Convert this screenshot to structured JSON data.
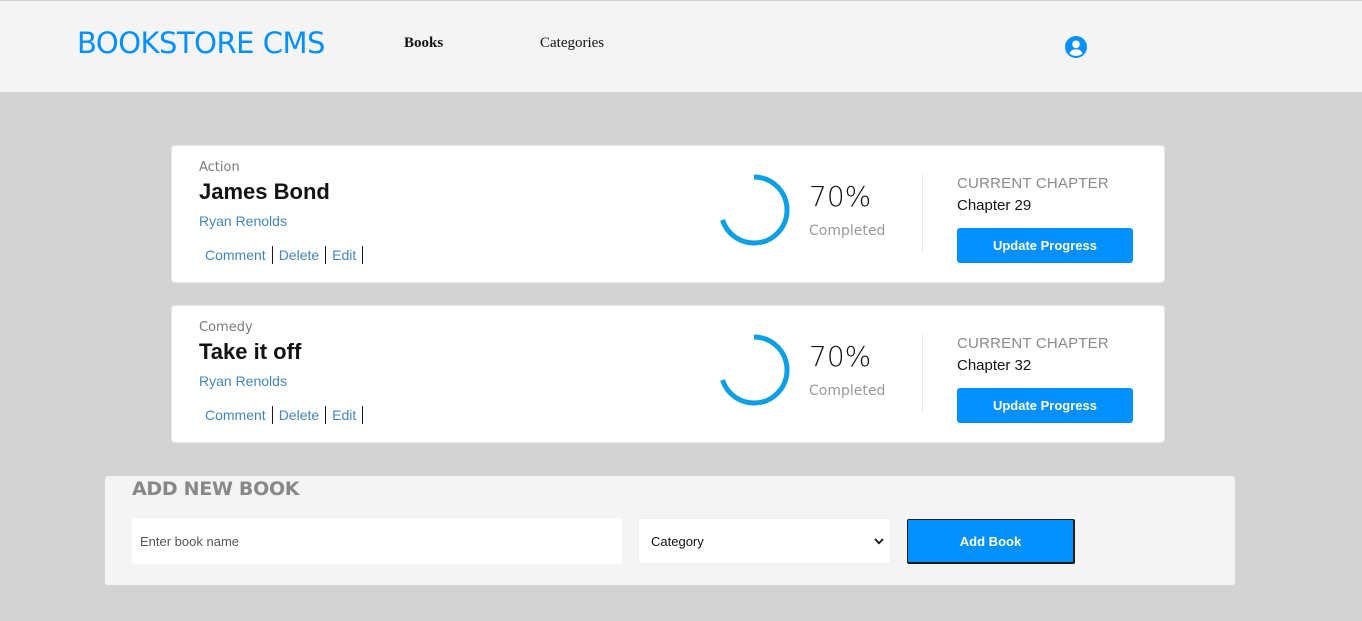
{
  "header": {
    "brand": "BOOKSTORE CMS",
    "nav": {
      "books": "Books",
      "categories": "Categories"
    },
    "user_icon": "user-circle-icon"
  },
  "books": [
    {
      "genre": "Action",
      "title": "James Bond",
      "author": "Ryan Renolds",
      "actions": {
        "comment": "Comment",
        "delete": "Delete",
        "edit": "Edit"
      },
      "progress": 70,
      "percent_label": "70%",
      "completed_label": "Completed",
      "chapter_label": "CURRENT CHAPTER",
      "chapter": "Chapter 29",
      "update_label": "Update Progress"
    },
    {
      "genre": "Comedy",
      "title": "Take it off",
      "author": "Ryan Renolds",
      "actions": {
        "comment": "Comment",
        "delete": "Delete",
        "edit": "Edit"
      },
      "progress": 70,
      "percent_label": "70%",
      "completed_label": "Completed",
      "chapter_label": "CURRENT CHAPTER",
      "chapter": "Chapter 32",
      "update_label": "Update Progress"
    }
  ],
  "add_book": {
    "title": "ADD NEW BOOK",
    "name_placeholder": "Enter book name",
    "category_selected": "Category",
    "submit_label": "Add Book"
  },
  "colors": {
    "accent": "#0290ff",
    "progress": "#0d9fe4",
    "background": "#d3d3d3",
    "header_bg": "#f4f4f4"
  }
}
